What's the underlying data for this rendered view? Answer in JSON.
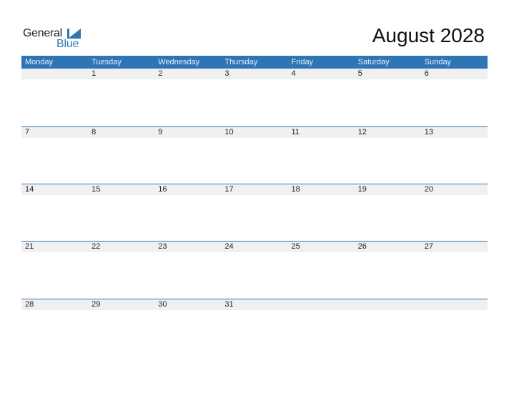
{
  "logo": {
    "line1": "General",
    "line2": "Blue"
  },
  "title": "August 2028",
  "colors": {
    "accent": "#2e75b6",
    "strip": "#f0f0f0"
  },
  "days_of_week": [
    "Monday",
    "Tuesday",
    "Wednesday",
    "Thursday",
    "Friday",
    "Saturday",
    "Sunday"
  ],
  "weeks": [
    [
      "",
      "1",
      "2",
      "3",
      "4",
      "5",
      "6"
    ],
    [
      "7",
      "8",
      "9",
      "10",
      "11",
      "12",
      "13"
    ],
    [
      "14",
      "15",
      "16",
      "17",
      "18",
      "19",
      "20"
    ],
    [
      "21",
      "22",
      "23",
      "24",
      "25",
      "26",
      "27"
    ],
    [
      "28",
      "29",
      "30",
      "31",
      "",
      "",
      ""
    ]
  ]
}
